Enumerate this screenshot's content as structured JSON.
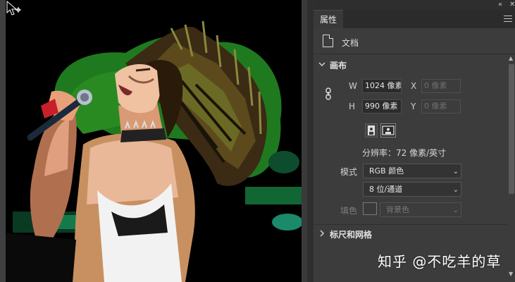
{
  "panel": {
    "tab_label": "属性",
    "topbar_icons": [
      "double-chevron-left-icon",
      "close-icon"
    ],
    "doc_label": "文档"
  },
  "canvas_section": {
    "title": "画布",
    "width_label": "W",
    "width_value": "1024 像素",
    "height_label": "H",
    "height_value": "990 像素",
    "x_label": "X",
    "x_value": "0 像素",
    "y_label": "Y",
    "y_value": "0 像素",
    "resolution_text": "分辨率：72 像素/英寸",
    "mode_label": "模式",
    "mode_value": "RGB 颜色",
    "depth_value": "8 位/通道",
    "fill_label": "填色",
    "fill_value": "背景色"
  },
  "ruler_section": {
    "title": "标尺和网格"
  },
  "watermark": "知乎 @不吃羊的草",
  "colors": {
    "panel_bg": "#3c3c3c",
    "field_bg": "#2b2b2b",
    "accent_green": "#1f7a1f",
    "skin_tone": "#e8a07a"
  }
}
